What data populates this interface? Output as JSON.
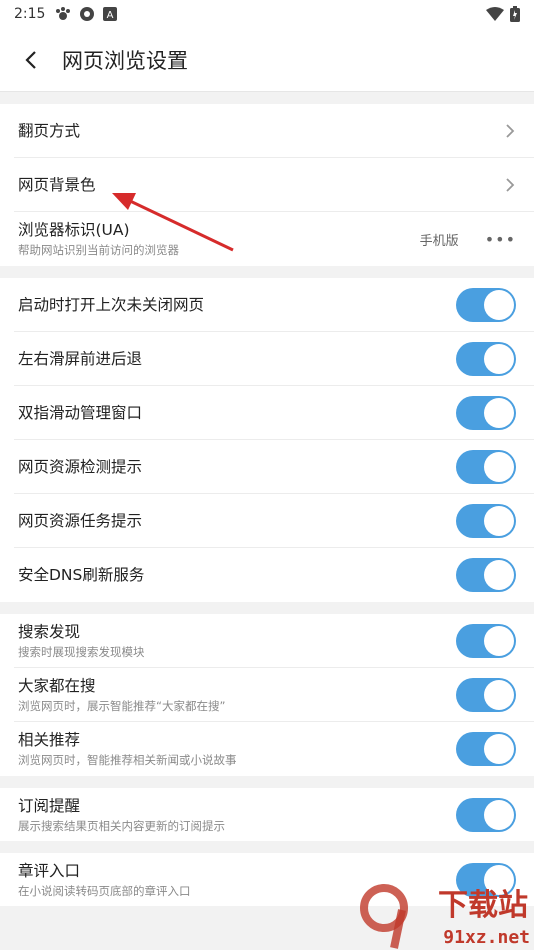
{
  "status": {
    "time": "2:15"
  },
  "header": {
    "title": "网页浏览设置"
  },
  "group1": {
    "page_turn": "翻页方式",
    "bg_color": "网页背景色",
    "ua_title": "浏览器标识(UA)",
    "ua_sub": "帮助网站识别当前访问的浏览器",
    "ua_value": "手机版",
    "ua_more": "•••"
  },
  "group2": [
    {
      "label": "启动时打开上次未关闭网页",
      "on": true
    },
    {
      "label": "左右滑屏前进后退",
      "on": true
    },
    {
      "label": "双指滑动管理窗口",
      "on": true
    },
    {
      "label": "网页资源检测提示",
      "on": true
    },
    {
      "label": "网页资源任务提示",
      "on": true
    },
    {
      "label": "安全DNS刷新服务",
      "on": true
    }
  ],
  "group3": [
    {
      "label": "搜索发现",
      "sub": "搜索时展现搜索发现模块",
      "on": true
    },
    {
      "label": "大家都在搜",
      "sub": "浏览网页时，展示智能推荐“大家都在搜”",
      "on": true
    },
    {
      "label": "相关推荐",
      "sub": "浏览网页时，智能推荐相关新闻或小说故事",
      "on": true
    }
  ],
  "group4": [
    {
      "label": "订阅提醒",
      "sub": "展示搜索结果页相关内容更新的订阅提示",
      "on": true
    }
  ],
  "group5": [
    {
      "label": "章评入口",
      "sub": "在小说阅读转码页底部的章评入口",
      "on": true
    }
  ],
  "watermark": {
    "text": "下载站",
    "url": "91xz.net"
  },
  "colors": {
    "toggle_on": "#4a9fe0",
    "arrow": "#d62b2b"
  }
}
